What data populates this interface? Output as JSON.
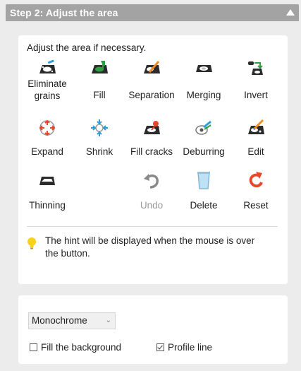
{
  "header": {
    "title": "Step 2: Adjust the area"
  },
  "panel": {
    "intro": "Adjust the area if necessary."
  },
  "tools": [
    {
      "label": "Eliminate\ngrains",
      "icon": "eliminate-grains-icon"
    },
    {
      "label": "Fill",
      "icon": "fill-icon"
    },
    {
      "label": "Separation",
      "icon": "separation-icon"
    },
    {
      "label": "Merging",
      "icon": "merging-icon"
    },
    {
      "label": "Invert",
      "icon": "invert-icon"
    },
    {
      "label": "Expand",
      "icon": "expand-icon"
    },
    {
      "label": "Shrink",
      "icon": "shrink-icon"
    },
    {
      "label": "Fill cracks",
      "icon": "fill-cracks-icon"
    },
    {
      "label": "Deburring",
      "icon": "deburring-icon"
    },
    {
      "label": "Edit",
      "icon": "edit-icon"
    },
    {
      "label": "Thinning",
      "icon": "thinning-icon"
    },
    {
      "label": "Undo",
      "icon": "undo-icon",
      "disabled": true
    },
    {
      "label": "Delete",
      "icon": "delete-icon"
    },
    {
      "label": "Reset",
      "icon": "reset-icon"
    }
  ],
  "hint": {
    "text": "The hint will be displayed when the mouse is over the button."
  },
  "options": {
    "mode_selected": "Monochrome",
    "fill_background_label": "Fill the background",
    "fill_background_checked": false,
    "profile_line_label": "Profile line",
    "profile_line_checked": true
  },
  "colors": {
    "header": "#a3a3a3",
    "accent_green": "#2ea043",
    "accent_orange": "#f08a24",
    "accent_blue": "#2a9fd8",
    "reset_red": "#e8472a"
  }
}
